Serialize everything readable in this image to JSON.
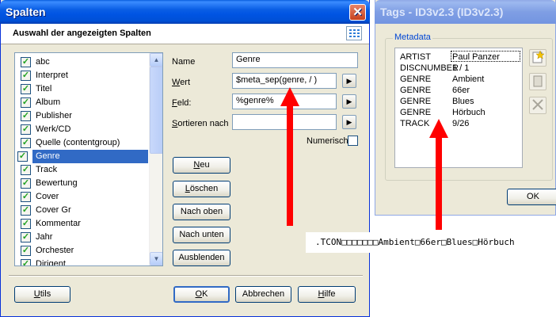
{
  "spalten": {
    "title": "Spalten",
    "close_glyph": "✕",
    "header": "Auswahl der angezeigten Spalten",
    "columns": [
      {
        "label": "abc",
        "checked": true
      },
      {
        "label": "Interpret",
        "checked": true
      },
      {
        "label": "Titel",
        "checked": true
      },
      {
        "label": "Album",
        "checked": true
      },
      {
        "label": "Publisher",
        "checked": true
      },
      {
        "label": "Werk/CD",
        "checked": true
      },
      {
        "label": "Quelle (contentgroup)",
        "checked": true
      },
      {
        "label": "Genre",
        "checked": true,
        "selected": true
      },
      {
        "label": "Track",
        "checked": true
      },
      {
        "label": "Bewertung",
        "checked": true
      },
      {
        "label": "Cover",
        "checked": true
      },
      {
        "label": "Cover Gr",
        "checked": true
      },
      {
        "label": "Kommentar",
        "checked": true
      },
      {
        "label": "Jahr",
        "checked": true
      },
      {
        "label": "Orchester",
        "checked": true
      },
      {
        "label": "Dirigent",
        "checked": true
      }
    ],
    "name_label": "Name",
    "name_value": "Genre",
    "wert_label": "Wert",
    "wert_value": "$meta_sep(genre, / )",
    "feld_label": "Feld:",
    "feld_value": "%genre%",
    "sort_label": "Sortieren nach",
    "sort_value": "",
    "numerisch_label": "Numerisch",
    "buttons": {
      "neu": "Neu",
      "loeschen": "Löschen",
      "nach_oben": "Nach oben",
      "nach_unten": "Nach unten",
      "ausblenden": "Ausblenden",
      "utils": "Utils",
      "ok": "OK",
      "abbrechen": "Abbrechen",
      "hilfe": "Hilfe"
    },
    "check_glyph": "✓",
    "scroll_up": "▲",
    "scroll_down": "▼",
    "field_arrow": "▶"
  },
  "tags": {
    "title": "Tags - ID3v2.3 (ID3v2.3)",
    "group_label": "Metadata",
    "rows": [
      {
        "key": "ARTIST",
        "value": "Paul Panzer"
      },
      {
        "key": "DISCNUMBER",
        "value": "1 / 1"
      },
      {
        "key": "GENRE",
        "value": "Ambient"
      },
      {
        "key": "GENRE",
        "value": "66er"
      },
      {
        "key": "GENRE",
        "value": "Blues"
      },
      {
        "key": "GENRE",
        "value": "Hörbuch"
      },
      {
        "key": "TRACK",
        "value": "9/26"
      }
    ],
    "ok_label": "OK"
  },
  "raw_bytes": ".TCON□□□□□□□Ambient□66er□Blues□Hörbuch",
  "colors": {
    "arrow": "#ff0000",
    "selection": "#316ac5",
    "group_label": "#0046d5"
  }
}
